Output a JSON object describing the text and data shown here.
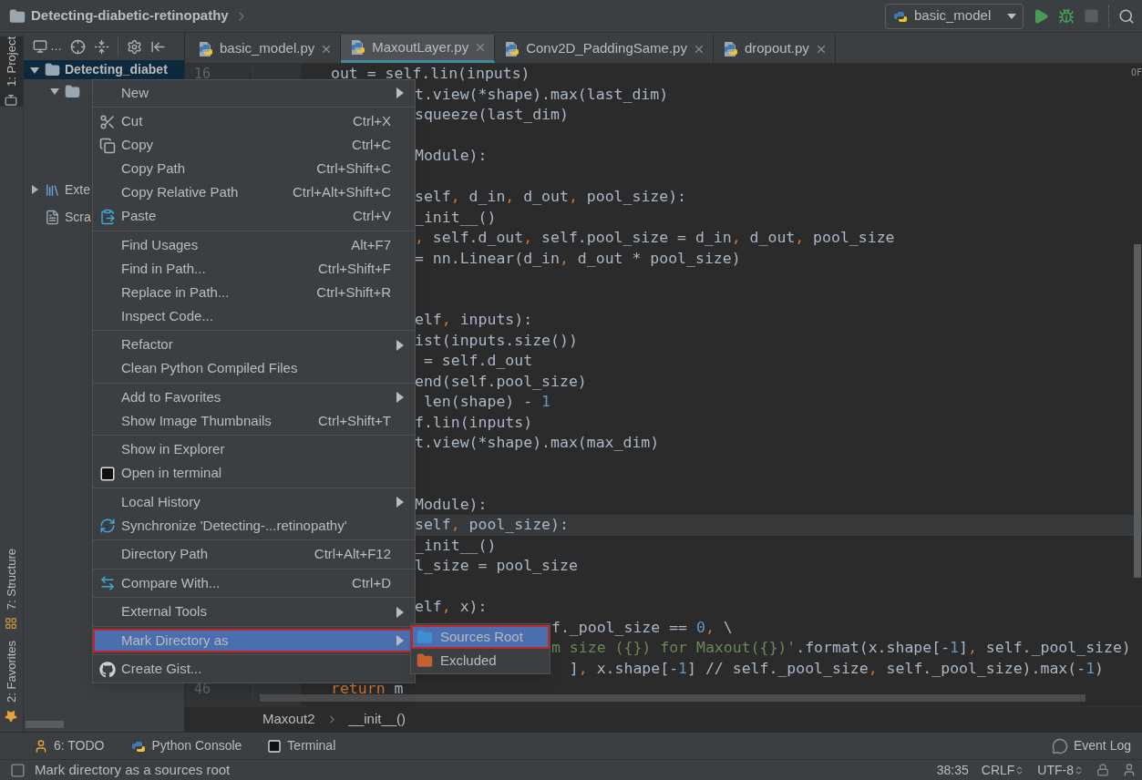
{
  "title_bar": {
    "project": "Detecting-diabetic-retinopathy",
    "run_config": "basic_model"
  },
  "left_stripe": {
    "top": [
      {
        "label": "1: Project",
        "kind": "project",
        "selected": true
      }
    ],
    "bottom": [
      {
        "label": "7: Structure",
        "kind": "structure",
        "selected": false
      },
      {
        "label": "2: Favorites",
        "kind": "favorites",
        "selected": false
      }
    ]
  },
  "project_panel": {
    "view_selector": "…",
    "tree": [
      {
        "label": "Detecting_diabet",
        "kind": "folder",
        "expanded": true,
        "selected": true,
        "children": [
          {
            "kind": "module",
            "expanded": true,
            "selected": false
          }
        ]
      },
      {
        "label": "Exte",
        "kind": "library",
        "expanded": false,
        "selected": false
      },
      {
        "label": "Scra",
        "kind": "scratches",
        "selected": false
      }
    ]
  },
  "tabs": [
    {
      "label": "basic_model.py",
      "selected": false
    },
    {
      "label": "MaxoutLayer.py",
      "selected": true
    },
    {
      "label": "Conv2D_PaddingSame.py",
      "selected": false
    },
    {
      "label": "dropout.py",
      "selected": false
    }
  ],
  "editor": {
    "corner_text": "OF",
    "lines": [
      {
        "number": "16",
        "current": false,
        "segments": [
          {
            "kind": "code",
            "text": "out = self.lin(inputs)"
          }
        ]
      },
      {
        "current": false,
        "segments": [
          {
            "kind": "code",
            "text": "t.view(*shape).max(last_dim)"
          }
        ]
      },
      {
        "current": false,
        "segments": [
          {
            "kind": "code",
            "text": "squeeze(last_dim)"
          }
        ]
      },
      {
        "current": false
      },
      {
        "current": false,
        "segments": [
          {
            "kind": "code",
            "text": "Module):"
          }
        ]
      },
      {
        "current": false
      },
      {
        "current": false,
        "segments": [
          {
            "kind": "code",
            "text": "self, d_in, d_out, pool_size):"
          }
        ]
      },
      {
        "current": false,
        "segments": [
          {
            "kind": "code",
            "text": "_init__()"
          }
        ]
      },
      {
        "current": false,
        "segments": [
          {
            "kind": "code",
            "text": ", self.d_out, self.pool_size = d_in, d_out, pool_size"
          }
        ]
      },
      {
        "current": false,
        "segments": [
          {
            "kind": "code",
            "text": "= nn.Linear(d_in, d_out * pool_size)"
          }
        ]
      },
      {
        "current": false
      },
      {
        "current": false
      },
      {
        "current": false,
        "segments": [
          {
            "kind": "code",
            "text": "elf, inputs):"
          }
        ]
      },
      {
        "current": false,
        "segments": [
          {
            "kind": "code",
            "text": "ist(inputs.size())"
          }
        ]
      },
      {
        "current": false,
        "segments": [
          {
            "kind": "code",
            "text": " = self.d_out"
          }
        ]
      },
      {
        "current": false,
        "segments": [
          {
            "kind": "code",
            "text": "end(self.pool_size)"
          }
        ]
      },
      {
        "current": false,
        "segments": [
          {
            "kind": "code",
            "text": " len(shape) - 1"
          }
        ]
      },
      {
        "current": false,
        "segments": [
          {
            "kind": "code",
            "text": "f.lin(inputs)"
          }
        ]
      },
      {
        "current": false,
        "segments": [
          {
            "kind": "code",
            "text": "t.view(*shape).max(max_dim)"
          }
        ]
      },
      {
        "current": false
      },
      {
        "current": false
      },
      {
        "current": false,
        "segments": [
          {
            "kind": "code",
            "text": "Module):"
          }
        ]
      },
      {
        "current": true,
        "segments": [
          {
            "kind": "code",
            "text": "self, pool_size):"
          }
        ]
      },
      {
        "current": false,
        "segments": [
          {
            "kind": "code",
            "text": "_init__()"
          }
        ]
      },
      {
        "current": false,
        "segments": [
          {
            "kind": "code",
            "text": "l_size = pool_size"
          }
        ]
      },
      {
        "current": false
      },
      {
        "current": false,
        "segments": [
          {
            "kind": "code",
            "text": "elf, x):"
          }
        ]
      },
      {
        "current": false,
        "segments": [
          {
            "kind": "code",
            "text": "f._pool_size == 0, \\"
          }
        ]
      },
      {
        "current": false,
        "segments": [
          {
            "kind": "string",
            "text": "m size ({}) for Maxout({})'"
          },
          {
            "kind": "code",
            "text": ".format(x.shape[-1], self._pool_size)"
          }
        ]
      },
      {
        "current": false,
        "segments": [
          {
            "kind": "code",
            "text": "  ], x.shape[-1] // self._pool_size, self._pool_size).max(-1)"
          }
        ]
      },
      {
        "number": "46",
        "current": false,
        "segments": [
          {
            "kind": "keyword",
            "text": "return"
          },
          {
            "kind": "code",
            "text": " m"
          }
        ]
      }
    ]
  },
  "breadcrumbs": [
    "Maxout2",
    "__init__()"
  ],
  "context_menu": {
    "groups": [
      {
        "items": [
          {
            "label": "New",
            "kind": "plain",
            "submenu": true,
            "selected": false
          }
        ]
      },
      {
        "items": [
          {
            "label": "Cut",
            "shortcut": "Ctrl+X",
            "kind": "cut",
            "submenu": false,
            "selected": false
          },
          {
            "label": "Copy",
            "shortcut": "Ctrl+C",
            "kind": "copy",
            "submenu": false,
            "selected": false
          },
          {
            "label": "Copy Path",
            "shortcut": "Ctrl+Shift+C",
            "kind": "plain",
            "submenu": false,
            "selected": false
          },
          {
            "label": "Copy Relative Path",
            "shortcut": "Ctrl+Alt+Shift+C",
            "kind": "plain",
            "submenu": false,
            "selected": false
          },
          {
            "label": "Paste",
            "shortcut": "Ctrl+V",
            "kind": "paste",
            "submenu": false,
            "selected": false
          }
        ]
      },
      {
        "items": [
          {
            "label": "Find Usages",
            "shortcut": "Alt+F7",
            "kind": "plain",
            "submenu": false,
            "selected": false
          },
          {
            "label": "Find in Path...",
            "shortcut": "Ctrl+Shift+F",
            "kind": "plain",
            "submenu": false,
            "selected": false
          },
          {
            "label": "Replace in Path...",
            "shortcut": "Ctrl+Shift+R",
            "kind": "plain",
            "submenu": false,
            "selected": false
          },
          {
            "label": "Inspect Code...",
            "kind": "plain",
            "submenu": false,
            "selected": false
          }
        ]
      },
      {
        "items": [
          {
            "label": "Refactor",
            "kind": "plain",
            "submenu": true,
            "selected": false
          },
          {
            "label": "Clean Python Compiled Files",
            "kind": "plain",
            "submenu": false,
            "selected": false
          }
        ]
      },
      {
        "items": [
          {
            "label": "Add to Favorites",
            "kind": "plain",
            "submenu": true,
            "selected": false
          },
          {
            "label": "Show Image Thumbnails",
            "shortcut": "Ctrl+Shift+T",
            "kind": "plain",
            "submenu": false,
            "selected": false
          }
        ]
      },
      {
        "items": [
          {
            "label": "Show in Explorer",
            "kind": "plain",
            "submenu": false,
            "selected": false
          },
          {
            "label": "Open in terminal",
            "kind": "terminal",
            "submenu": false,
            "selected": false
          }
        ]
      },
      {
        "items": [
          {
            "label": "Local History",
            "kind": "plain",
            "submenu": true,
            "selected": false
          },
          {
            "label": "Synchronize 'Detecting-...retinopathy'",
            "kind": "synchronize",
            "submenu": false,
            "selected": false
          }
        ]
      },
      {
        "items": [
          {
            "label": "Directory Path",
            "shortcut": "Ctrl+Alt+F12",
            "kind": "plain",
            "submenu": false,
            "selected": false
          }
        ]
      },
      {
        "items": [
          {
            "label": "Compare With...",
            "shortcut": "Ctrl+D",
            "kind": "compare",
            "submenu": false,
            "selected": false
          }
        ]
      },
      {
        "items": [
          {
            "label": "External Tools",
            "kind": "plain",
            "submenu": true,
            "selected": false
          }
        ]
      },
      {
        "items": [
          {
            "label": "Mark Directory as",
            "kind": "plain",
            "submenu": true,
            "selected": true
          }
        ]
      },
      {
        "items": [
          {
            "label": "Create Gist...",
            "kind": "gist",
            "submenu": false,
            "selected": false
          }
        ]
      }
    ],
    "submenu": {
      "items": [
        {
          "label": "Sources Root",
          "color": "#3d8fd1",
          "selected": true
        },
        {
          "label": "Excluded",
          "color": "#c4622f",
          "selected": false
        }
      ]
    }
  },
  "tool_windows": [
    {
      "label": "6: TODO",
      "kind": "todo"
    },
    {
      "label": "Python Console",
      "kind": "python_console"
    },
    {
      "label": "Terminal",
      "kind": "terminal"
    }
  ],
  "event_log": "Event Log",
  "status_bar": {
    "message": "Mark directory as a sources root",
    "position": "38:35",
    "line_separator": "CRLF",
    "encoding": "UTF-8"
  }
}
